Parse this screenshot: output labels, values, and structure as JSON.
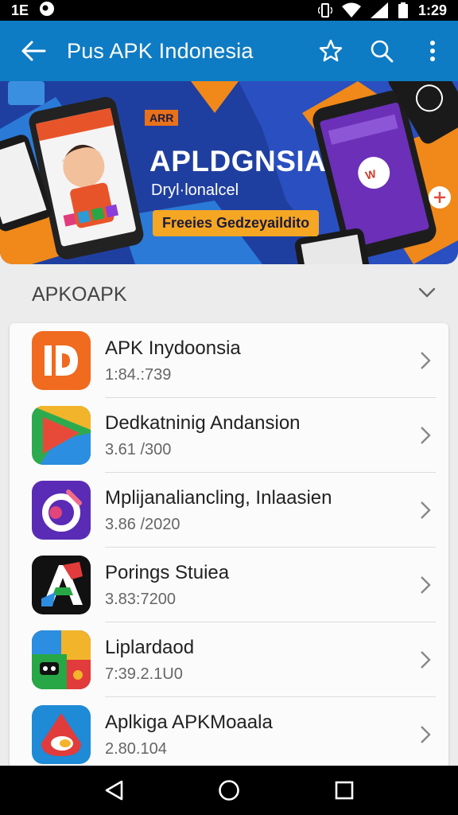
{
  "status_bar": {
    "left_text": "1E",
    "time": "1:29"
  },
  "app_bar": {
    "title": "Pus APK Indonesia"
  },
  "banner": {
    "tag": "ARR",
    "title": "APLDGNSIA",
    "subtitle": "Dryl·lonalcel",
    "button": "Freeies Gedzeyaildito"
  },
  "section": {
    "title": "APKOAPK"
  },
  "apps": [
    {
      "name": "APK Inydoonsia",
      "meta": "1:84.:739",
      "icon": "apk-orange-icon",
      "color": "#f06a1f"
    },
    {
      "name": "Dedkatninig Andansion",
      "meta": "3.61 /300",
      "icon": "play-triangle-icon",
      "color": "#2eaa4e"
    },
    {
      "name": "Mplijanaliancling, Inlaasien",
      "meta": "3.86 /2020",
      "icon": "purple-ring-icon",
      "color": "#5a2bb5"
    },
    {
      "name": "Porings Stuiea",
      "meta": "3.83:7200",
      "icon": "a-letter-icon",
      "color": "#111111"
    },
    {
      "name": "Liplardaod",
      "meta": "7:39.2.1U0",
      "icon": "colorful-puzzle-icon",
      "color": "#1f9b3a"
    },
    {
      "name": "Aplkiga APKMoaala",
      "meta": "2.80.104",
      "icon": "red-shield-icon",
      "color": "#1f8ad6"
    }
  ],
  "colors": {
    "app_bar": "#0e7cc4",
    "background": "#ececec",
    "banner_blue": "#1f3fa0",
    "banner_orange": "#f0891a"
  }
}
